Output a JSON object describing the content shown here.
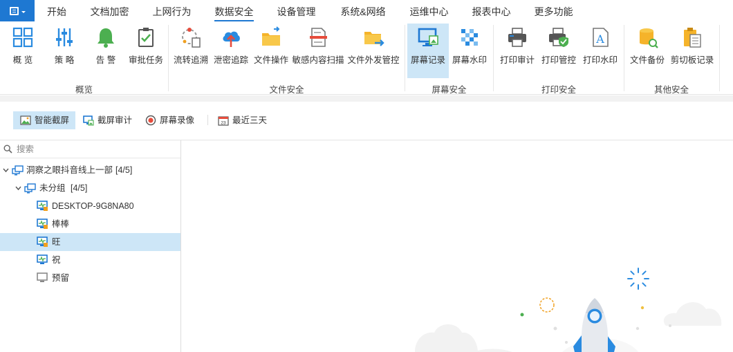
{
  "menu": {
    "tabs": [
      {
        "label": "开始"
      },
      {
        "label": "文档加密"
      },
      {
        "label": "上网行为"
      },
      {
        "label": "数据安全"
      },
      {
        "label": "设备管理"
      },
      {
        "label": "系统&网络"
      },
      {
        "label": "运维中心"
      },
      {
        "label": "报表中心"
      },
      {
        "label": "更多功能"
      }
    ],
    "active_tab": "数据安全"
  },
  "ribbon": {
    "groups": [
      {
        "label": "概览",
        "buttons": [
          {
            "label": "概 览",
            "icon": "grid-icon"
          },
          {
            "label": "策 略",
            "icon": "sliders-icon"
          },
          {
            "label": "告 警",
            "icon": "bell-icon"
          },
          {
            "label": "审批任务",
            "icon": "checklist-icon"
          }
        ]
      },
      {
        "label": "文件安全",
        "buttons": [
          {
            "label": "流转追溯",
            "icon": "trace-icon"
          },
          {
            "label": "泄密追踪",
            "icon": "cloud-upload-icon"
          },
          {
            "label": "文件操作",
            "icon": "folder-share-icon"
          },
          {
            "label": "敏感内容扫描",
            "icon": "document-scan-icon"
          },
          {
            "label": "文件外发管控",
            "icon": "folder-send-icon"
          }
        ]
      },
      {
        "label": "屏幕安全",
        "buttons": [
          {
            "label": "屏幕记录",
            "icon": "screen-record-icon"
          },
          {
            "label": "屏幕水印",
            "icon": "mosaic-icon"
          }
        ]
      },
      {
        "label": "打印安全",
        "buttons": [
          {
            "label": "打印审计",
            "icon": "printer-icon"
          },
          {
            "label": "打印管控",
            "icon": "printer-shield-icon"
          },
          {
            "label": "打印水印",
            "icon": "watermark-a-icon"
          }
        ]
      },
      {
        "label": "其他安全",
        "buttons": [
          {
            "label": "文件备份",
            "icon": "database-icon"
          },
          {
            "label": "剪切板记录",
            "icon": "clipboard-icon"
          }
        ]
      }
    ],
    "active_button": "屏幕记录"
  },
  "toolbar": {
    "smart_capture": "智能截屏",
    "capture_audit": "截屏审计",
    "screen_recording": "屏幕录像",
    "recent": "最近三天"
  },
  "sidebar": {
    "search_placeholder": "搜索",
    "tree": [
      {
        "label": "洞察之眼抖音线上一部",
        "count": "[4/5]"
      },
      {
        "label": "未分组",
        "count": "[4/5]"
      },
      {
        "label": "DESKTOP-9G8NA80",
        "status": "online"
      },
      {
        "label": "棒棒",
        "status": "online"
      },
      {
        "label": "旺",
        "status": "online",
        "selected": true
      },
      {
        "label": "祝",
        "status": "online"
      },
      {
        "label": "预留",
        "status": "offline"
      }
    ]
  },
  "colors": {
    "accent": "#1e78d2",
    "selected_bg": "#cde6f7",
    "icon_blue": "#2a8be0",
    "icon_green": "#4caf50",
    "icon_orange": "#f0a020",
    "icon_red": "#e74c3c"
  }
}
